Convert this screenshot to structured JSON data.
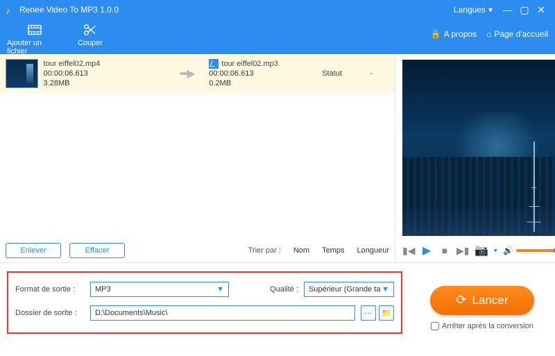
{
  "app": {
    "title": "Renee Video To MP3 1.0.0"
  },
  "titlebar": {
    "langs": "Langues"
  },
  "toolbar": {
    "add_file": "Ajouter un fichier",
    "cut": "Couper",
    "about": "A propos",
    "home": "Page d'accueil"
  },
  "file": {
    "src_name": "tour eiffel02.mp4",
    "src_dur": "00:00:06.613",
    "src_size": "3.28MB",
    "dst_name": "tour eiffel02.mp3",
    "dst_dur": "00:00:06.613",
    "dst_size": "0.2MB",
    "status_label": "Statut",
    "status_value": "-"
  },
  "listbar": {
    "remove": "Enlever",
    "clear": "Effacer",
    "sort_by": "Trier par :",
    "name": "Nom",
    "time": "Temps",
    "length": "Longueur"
  },
  "settings": {
    "format_label": "Format de sortie :",
    "format_value": "MP3",
    "quality_label": "Qualité :",
    "quality_value": "Supérieur (Grande ta",
    "folder_label": "Dossier de sorite :",
    "folder_value": "D:\\Documents\\Music\\"
  },
  "launch": {
    "button": "Lancer",
    "stop_after": "Arrêter après la conversion"
  },
  "icons": {
    "film": "film-icon",
    "scissors": "scissors-icon"
  }
}
